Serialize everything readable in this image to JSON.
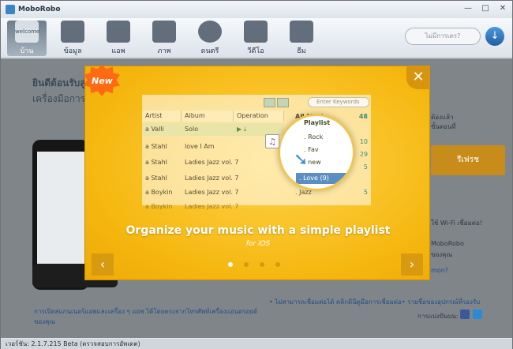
{
  "window": {
    "title": "MoboRobo",
    "minimize": "—",
    "maximize": "□",
    "close": "✕"
  },
  "toolbar": {
    "tabs": [
      {
        "label": "บ้าน",
        "icon": "welcome-home-icon",
        "active": true
      },
      {
        "label": "ข้อมูล",
        "icon": "contacts-icon",
        "active": false
      },
      {
        "label": "แอพ",
        "icon": "apps-icon",
        "active": false
      },
      {
        "label": "ภาพ",
        "icon": "photos-icon",
        "active": false
      },
      {
        "label": "ดนตรี",
        "icon": "music-icon",
        "active": false
      },
      {
        "label": "วีดีโอ",
        "icon": "video-icon",
        "active": false
      },
      {
        "label": "ธีม",
        "icon": "theme-icon",
        "active": false
      }
    ],
    "welcome_icon_text": "welcome",
    "search_label": "ไม่มีการเตร?",
    "download_icon": "download-icon"
  },
  "background": {
    "welcome_line1": "ยินดีต้อนรับสู่",
    "welcome_line2": "เครื่องมือการ",
    "gold_button": "รีเฟรช",
    "side_text_1": "ต้องแล้ว",
    "side_text_2": "ขั้นตอนที่",
    "side_text_3": "ใช้ Wi-Fi เชื่อมต่อ!",
    "side_text_4": "MoboRobo",
    "side_text_5": "ของคุณ",
    "side_text_6": "mon?",
    "bottom_link_left": "การเปิดสแกนเนอร์แอพและเครื่อง ๆ แอพ ได้โดยตรงจากโทรศัพท์เครื่องแอนดรอยด์ของคุณ",
    "bottom_link_mid": "• ไม่สามารถเชื่อมต่อได้ คลิกดีนีดูมือการเชื่อมต่อ",
    "bottom_link_right": "• รายชื่อของอุปกรณ์ที่รองรับ",
    "share_label": "การแบ่งปันบน:",
    "status": "เวอร์ชัน: 2.1.7.215 Beta (ตรวจสอบการอัพเดต)"
  },
  "overlay": {
    "badge": "New",
    "close": "✕",
    "table_header": [
      "Artist",
      "Album",
      "Operation"
    ],
    "rows": [
      {
        "artist": "a Valli",
        "album": "Solo"
      },
      {
        "artist": "a Stahl",
        "album": "love I Am"
      },
      {
        "artist": "a Stahl",
        "album": "Ladies Jazz vol. 7"
      },
      {
        "artist": "a Stahl",
        "album": "Ladies Jazz vol. 7"
      },
      {
        "artist": "a Boykin",
        "album": "Ladies Jazz vol. 7"
      },
      {
        "artist": "a Boykin",
        "album": "Ladies Jazz vol. 7"
      }
    ],
    "search_placeholder": "Enter Keywords",
    "side_list": [
      {
        "label": "All Music",
        "count": "48"
      },
      {
        "label": "Playlist",
        "count": ""
      },
      {
        "label": ". Rock",
        "count": "10"
      },
      {
        "label": ". Fav",
        "count": "29"
      },
      {
        "label": ". new",
        "count": "5"
      },
      {
        "label": ". Love (9)",
        "count": ""
      },
      {
        "label": ". Jazz",
        "count": "5"
      }
    ],
    "headline": "Organize your music with a simple playlist",
    "subline": "for iOS",
    "prev": "‹",
    "next": "›",
    "active_slide": 0,
    "slide_count": 4
  }
}
